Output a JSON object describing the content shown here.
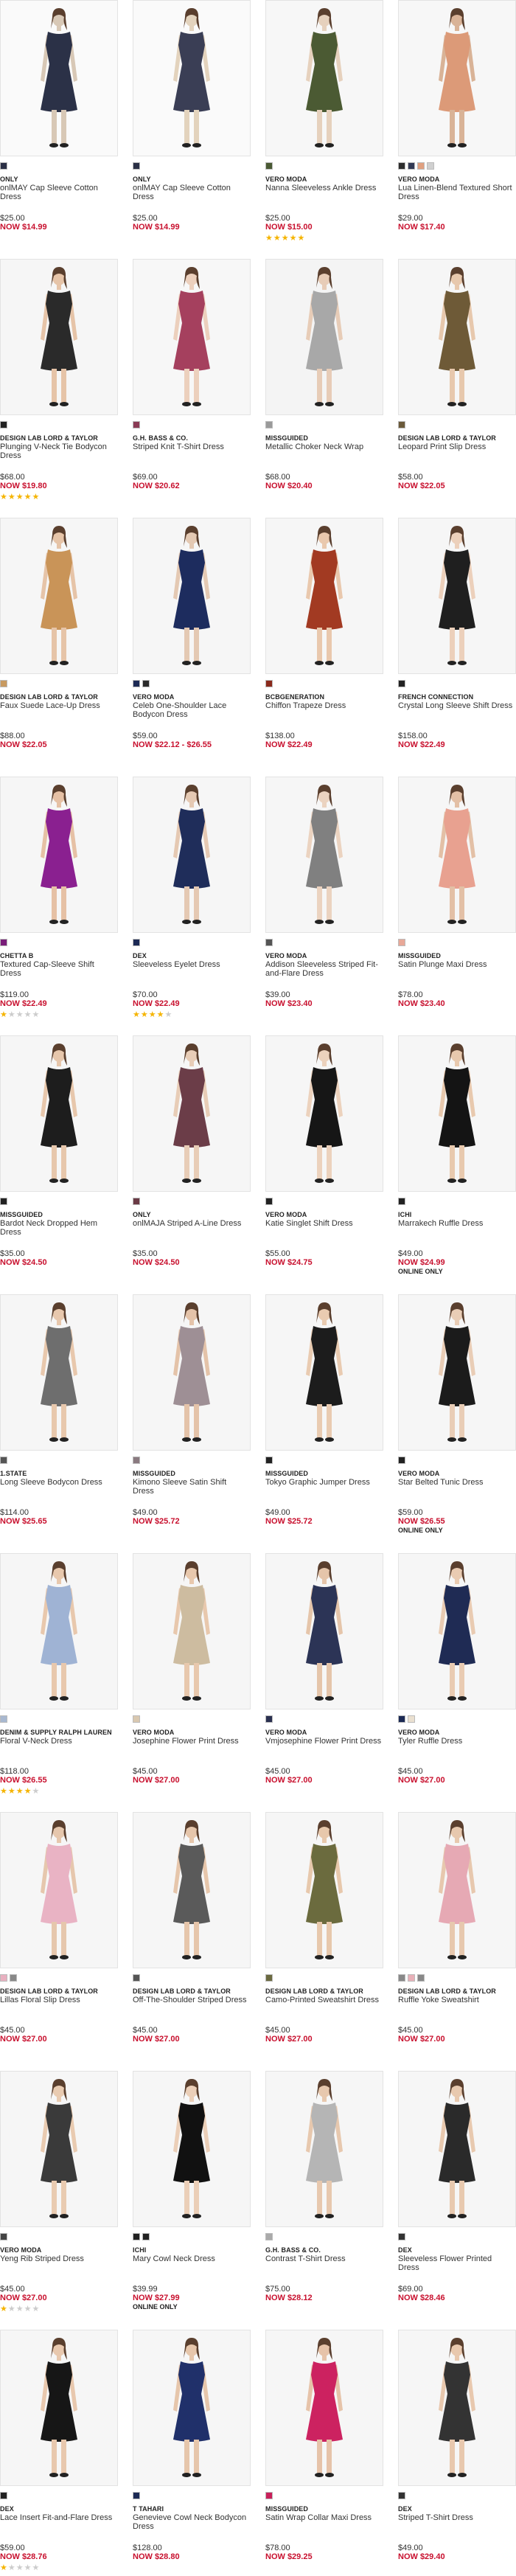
{
  "products": [
    {
      "brand": "ONLY",
      "name": "onlMAY Cap Sleeve Cotton Dress",
      "price": "$25.00",
      "sale": "NOW $14.99",
      "swatches": [
        "#2a2f45"
      ],
      "colors": [
        "#2b3147",
        "#d8c8b6",
        "#fafafa"
      ],
      "online": "",
      "rating": 0
    },
    {
      "brand": "ONLY",
      "name": "onlMAY Cap Sleeve Cotton Dress",
      "price": "$25.00",
      "sale": "NOW $14.99",
      "swatches": [
        "#2a2f45"
      ],
      "colors": [
        "#3a3e55",
        "#e3d3bd",
        "#fafafa"
      ],
      "online": "",
      "rating": 0
    },
    {
      "brand": "VERO MODA",
      "name": "Nanna Sleeveless Ankle Dress",
      "price": "$25.00",
      "sale": "NOW $15.00",
      "swatches": [
        "#4a5a34"
      ],
      "colors": [
        "#4b5a33",
        "#e6d1bd",
        "#f7f7f7"
      ],
      "online": "",
      "rating": 5
    },
    {
      "brand": "VERO MODA",
      "name": "Lua Linen-Blend Textured Short Dress",
      "price": "$29.00",
      "sale": "NOW $17.40",
      "swatches": [
        "#2d2d2d",
        "#333a55",
        "#e0a080",
        "#d0d0d0"
      ],
      "colors": [
        "#dc9a78",
        "#d9b397",
        "#f7f7f7"
      ],
      "online": "",
      "rating": 0
    },
    {
      "brand": "DESIGN LAB LORD & TAYLOR",
      "name": "Plunging V-Neck Tie Bodycon Dress",
      "price": "$68.00",
      "sale": "NOW $19.80",
      "swatches": [
        "#222222"
      ],
      "colors": [
        "#2a2a2a",
        "#e6c4a8",
        "#f6f6f6"
      ],
      "online": "",
      "rating": 5
    },
    {
      "brand": "G.H. BASS & CO.",
      "name": "Striped Knit T-Shirt Dress",
      "price": "$69.00",
      "sale": "NOW $20.62",
      "swatches": [
        "#8a3a55"
      ],
      "colors": [
        "#a5405e",
        "#ecd0bd",
        "#f7f7f7"
      ],
      "online": "",
      "rating": 0
    },
    {
      "brand": "MISSGUIDED",
      "name": "Metallic Choker Neck Wrap",
      "price": "$68.00",
      "sale": "NOW $20.40",
      "swatches": [
        "#9a9a9a"
      ],
      "colors": [
        "#a8a8a8",
        "#e7ccb7",
        "#f4f4f4"
      ],
      "online": "",
      "rating": 0
    },
    {
      "brand": "DESIGN LAB LORD & TAYLOR",
      "name": "Leopard Print Slip Dress",
      "price": "$58.00",
      "sale": "NOW $22.05",
      "swatches": [
        "#6b5a3a"
      ],
      "colors": [
        "#6e5a37",
        "#e7c8ad",
        "#f6f6f6"
      ],
      "online": "",
      "rating": 0
    },
    {
      "brand": "DESIGN LAB LORD & TAYLOR",
      "name": "Faux Suede Lace-Up Dress",
      "price": "$88.00",
      "sale": "NOW $22.05",
      "swatches": [
        "#c89a60"
      ],
      "colors": [
        "#c99458",
        "#e6c4a8",
        "#f6f6f6"
      ],
      "online": "",
      "rating": 0
    },
    {
      "brand": "VERO MODA",
      "name": "Celeb One-Shoulder Lace Bodycon Dress",
      "price": "$59.00",
      "sale": "NOW $22.12 - $26.55",
      "swatches": [
        "#1c2a55",
        "#2a2a2a"
      ],
      "colors": [
        "#1d2c5e",
        "#e4c9b3",
        "#f6f6f6"
      ],
      "online": "",
      "rating": 0
    },
    {
      "brand": "BCBGENERATION",
      "name": "Chiffon Trapeze Dress",
      "price": "$138.00",
      "sale": "NOW $22.49",
      "swatches": [
        "#8a2a1c"
      ],
      "colors": [
        "#a23a22",
        "#e9c8ad",
        "#f6f6f6"
      ],
      "online": "",
      "rating": 0
    },
    {
      "brand": "FRENCH CONNECTION",
      "name": "Crystal Long Sleeve Shift Dress",
      "price": "$158.00",
      "sale": "NOW $22.49",
      "swatches": [
        "#222222"
      ],
      "colors": [
        "#1f1f1f",
        "#ecd0bb",
        "#f6f6f6"
      ],
      "online": "",
      "rating": 0
    },
    {
      "brand": "CHETTA B",
      "name": "Textured Cap-Sleeve Shift Dress",
      "price": "$119.00",
      "sale": "NOW $22.49",
      "swatches": [
        "#7a1e7a"
      ],
      "colors": [
        "#8a2090",
        "#e6c1a5",
        "#f6f6f6"
      ],
      "online": "",
      "rating": 1
    },
    {
      "brand": "DEX",
      "name": "Sleeveless Eyelet Dress",
      "price": "$70.00",
      "sale": "NOW $22.49",
      "swatches": [
        "#1c2a55"
      ],
      "colors": [
        "#1f2d5a",
        "#e5c9b3",
        "#f6f6f6"
      ],
      "online": "",
      "rating": 4
    },
    {
      "brand": "VERO MODA",
      "name": "Addison Sleeveless Striped Fit-and-Flare Dress",
      "price": "$39.00",
      "sale": "NOW $23.40",
      "swatches": [
        "#555555"
      ],
      "colors": [
        "#808080",
        "#ebd3c0",
        "#f6f6f6"
      ],
      "online": "",
      "rating": 0
    },
    {
      "brand": "MISSGUIDED",
      "name": "Satin Plunge Maxi Dress",
      "price": "$78.00",
      "sale": "NOW $23.40",
      "swatches": [
        "#e8a898"
      ],
      "colors": [
        "#e8a190",
        "#e3c0a6",
        "#f6f6f6"
      ],
      "online": "",
      "rating": 0
    },
    {
      "brand": "MISSGUIDED",
      "name": "Bardot Neck Dropped Hem Dress",
      "price": "$35.00",
      "sale": "NOW $24.50",
      "swatches": [
        "#222222"
      ],
      "colors": [
        "#1d1d1d",
        "#e7c7ac",
        "#f6f6f6"
      ],
      "online": "",
      "rating": 0
    },
    {
      "brand": "ONLY",
      "name": "onlMAJA Striped A-Line Dress",
      "price": "$35.00",
      "sale": "NOW $24.50",
      "swatches": [
        "#6a3a45"
      ],
      "colors": [
        "#6b3d48",
        "#e8cdb7",
        "#f6f6f6"
      ],
      "online": "",
      "rating": 0
    },
    {
      "brand": "VERO MODA",
      "name": "Katie Singlet Shift Dress",
      "price": "$55.00",
      "sale": "NOW $24.75",
      "swatches": [
        "#222222"
      ],
      "colors": [
        "#161616",
        "#ecd2bd",
        "#f6f6f6"
      ],
      "online": "",
      "rating": 0
    },
    {
      "brand": "ICHI",
      "name": "Marrakech Ruffle Dress",
      "price": "$49.00",
      "sale": "NOW $24.99",
      "swatches": [
        "#222222"
      ],
      "colors": [
        "#141414",
        "#e8c9ae",
        "#f6f6f6"
      ],
      "online": "ONLINE ONLY",
      "rating": 0
    },
    {
      "brand": "1.STATE",
      "name": "Long Sleeve Bodycon Dress",
      "price": "$114.00",
      "sale": "NOW $25.65",
      "swatches": [
        "#555555"
      ],
      "colors": [
        "#6e6e6e",
        "#e8c8ad",
        "#f6f6f6"
      ],
      "online": "",
      "rating": 0
    },
    {
      "brand": "MISSGUIDED",
      "name": "Kimono Sleeve Satin Shift Dress",
      "price": "$49.00",
      "sale": "NOW $25.72",
      "swatches": [
        "#8a7a80"
      ],
      "colors": [
        "#9e8f95",
        "#e4c3a9",
        "#f6f6f6"
      ],
      "online": "",
      "rating": 0
    },
    {
      "brand": "MISSGUIDED",
      "name": "Tokyo Graphic Jumper Dress",
      "price": "$49.00",
      "sale": "NOW $25.72",
      "swatches": [
        "#222222"
      ],
      "colors": [
        "#1c1c1c",
        "#e9cbb1",
        "#f6f6f6"
      ],
      "online": "",
      "rating": 0
    },
    {
      "brand": "VERO MODA",
      "name": "Star Belted Tunic Dress",
      "price": "$59.00",
      "sale": "NOW $26.55",
      "swatches": [
        "#222222"
      ],
      "colors": [
        "#1b1b1b",
        "#e9cdb6",
        "#f6f6f6"
      ],
      "online": "ONLINE ONLY",
      "rating": 0
    },
    {
      "brand": "DENIM & SUPPLY RALPH LAUREN",
      "name": "Floral V-Neck Dress",
      "price": "$118.00",
      "sale": "NOW $26.55",
      "swatches": [
        "#a8b8d0"
      ],
      "colors": [
        "#9fb3d4",
        "#e8c8ad",
        "#f6f6f6"
      ],
      "online": "",
      "rating": 4
    },
    {
      "brand": "VERO MODA",
      "name": "Josephine Flower Print Dress",
      "price": "$45.00",
      "sale": "NOW $27.00",
      "swatches": [
        "#d9c8b0"
      ],
      "colors": [
        "#cdbca0",
        "#e8c8ad",
        "#f6f6f6"
      ],
      "online": "",
      "rating": 0
    },
    {
      "brand": "VERO MODA",
      "name": "Vmjosephine Flower Print Dress",
      "price": "$45.00",
      "sale": "NOW $27.00",
      "swatches": [
        "#2a3050"
      ],
      "colors": [
        "#2c3456",
        "#e5c5aa",
        "#f6f6f6"
      ],
      "online": "",
      "rating": 0
    },
    {
      "brand": "VERO MODA",
      "name": "Tyler Ruffle Dress",
      "price": "$45.00",
      "sale": "NOW $27.00",
      "swatches": [
        "#1c2a55",
        "#eae0d0"
      ],
      "colors": [
        "#1f2b54",
        "#e9cbb2",
        "#f6f6f6"
      ],
      "online": "",
      "rating": 0
    },
    {
      "brand": "DESIGN LAB LORD & TAYLOR",
      "name": "Lillas Floral Slip Dress",
      "price": "$45.00",
      "sale": "NOW $27.00",
      "swatches": [
        "#e8b0c0",
        "#888888"
      ],
      "colors": [
        "#e9b3c4",
        "#e6c7ad",
        "#f6f6f6"
      ],
      "online": "",
      "rating": 0
    },
    {
      "brand": "DESIGN LAB LORD & TAYLOR",
      "name": "Off-The-Shoulder Striped Dress",
      "price": "$45.00",
      "sale": "NOW $27.00",
      "swatches": [
        "#555555"
      ],
      "colors": [
        "#5a5a5a",
        "#e6c6ab",
        "#f6f6f6"
      ],
      "online": "",
      "rating": 0
    },
    {
      "brand": "DESIGN LAB LORD & TAYLOR",
      "name": "Camo-Printed Sweatshirt Dress",
      "price": "$45.00",
      "sale": "NOW $27.00",
      "swatches": [
        "#6b6a40"
      ],
      "colors": [
        "#6b6b3e",
        "#e7c8ac",
        "#f6f6f6"
      ],
      "online": "",
      "rating": 0
    },
    {
      "brand": "DESIGN LAB LORD & TAYLOR",
      "name": "Ruffle Yoke Sweatshirt",
      "price": "$45.00",
      "sale": "NOW $27.00",
      "swatches": [
        "#888888",
        "#e8b0b8",
        "#888888"
      ],
      "colors": [
        "#e6a9b4",
        "#e7c8ae",
        "#f6f6f6"
      ],
      "online": "",
      "rating": 0
    },
    {
      "brand": "VERO MODA",
      "name": "Yeng Rib Striped Dress",
      "price": "$45.00",
      "sale": "NOW $27.00",
      "swatches": [
        "#444444"
      ],
      "colors": [
        "#3a3a3a",
        "#e9cbb1",
        "#f6f6f6"
      ],
      "online": "",
      "rating": 1
    },
    {
      "brand": "ICHI",
      "name": "Mary Cowl Neck Dress",
      "price": "$39.99",
      "sale": "NOW $27.99",
      "swatches": [
        "#222222",
        "#222222"
      ],
      "colors": [
        "#111111",
        "#ebcfb8",
        "#f6f6f6"
      ],
      "online": "ONLINE ONLY",
      "rating": 0
    },
    {
      "brand": "G.H. BASS & CO.",
      "name": "Contrast T-Shirt Dress",
      "price": "$75.00",
      "sale": "NOW $28.12",
      "swatches": [
        "#aaaaaa"
      ],
      "colors": [
        "#b5b5b5",
        "#e7c8ae",
        "#f6f6f6"
      ],
      "online": "",
      "rating": 0
    },
    {
      "brand": "DEX",
      "name": "Sleeveless Flower Printed Dress",
      "price": "$69.00",
      "sale": "NOW $28.46",
      "swatches": [
        "#333333"
      ],
      "colors": [
        "#2a2a2a",
        "#e8c9af",
        "#f6f6f6"
      ],
      "online": "",
      "rating": 0
    },
    {
      "brand": "DEX",
      "name": "Lace Insert Fit-and-Flare Dress",
      "price": "$59.00",
      "sale": "NOW $28.76",
      "swatches": [
        "#222222"
      ],
      "colors": [
        "#161616",
        "#e8c8ae",
        "#f6f6f6"
      ],
      "online": "",
      "rating": 1
    },
    {
      "brand": "T TAHARI",
      "name": "Genevieve Cowl Neck Bodycon Dress",
      "price": "$128.00",
      "sale": "NOW $28.80",
      "swatches": [
        "#1c2a55"
      ],
      "colors": [
        "#20306a",
        "#e6c6ab",
        "#f6f6f6"
      ],
      "online": "",
      "rating": 0
    },
    {
      "brand": "MISSGUIDED",
      "name": "Satin Wrap Collar Maxi Dress",
      "price": "$78.00",
      "sale": "NOW $29.25",
      "swatches": [
        "#c8205a"
      ],
      "colors": [
        "#cc2260",
        "#e6c3a9",
        "#f6f6f6"
      ],
      "online": "",
      "rating": 0
    },
    {
      "brand": "DEX",
      "name": "Striped T-Shirt Dress",
      "price": "$49.00",
      "sale": "NOW $29.40",
      "swatches": [
        "#333333"
      ],
      "colors": [
        "#333333",
        "#e8c8ae",
        "#f6f6f6"
      ],
      "online": "",
      "rating": 0
    }
  ]
}
